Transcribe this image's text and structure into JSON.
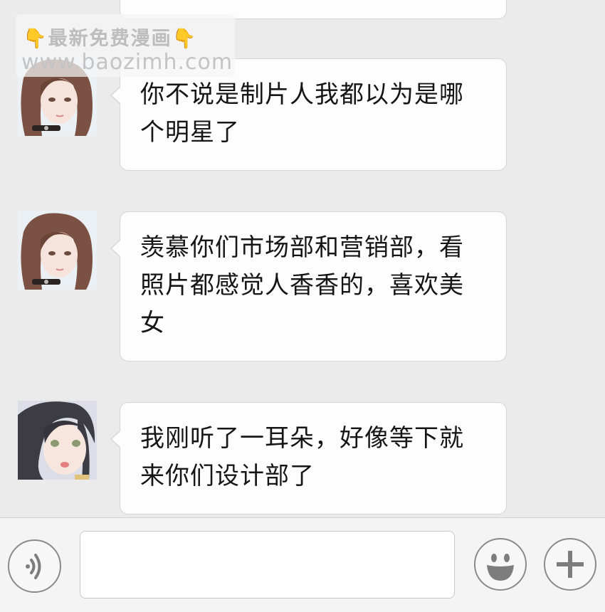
{
  "watermark": {
    "line1": "最新免费漫画",
    "hand_left": "👇",
    "hand_right": "👇",
    "line2": "www.baozimh.com"
  },
  "messages": [
    {
      "text": "你不说是制片人我都以为是哪个明星了"
    },
    {
      "text": "羡慕你们市场部和营销部，看照片都感觉人香香的，喜欢美女"
    },
    {
      "text": "我刚听了一耳朵，好像等下就来你们设计部了"
    }
  ],
  "input_bar": {
    "voice_icon": "voice-icon",
    "emoji_icon": "emoji-icon",
    "plus_icon": "plus-icon",
    "input_value": ""
  }
}
